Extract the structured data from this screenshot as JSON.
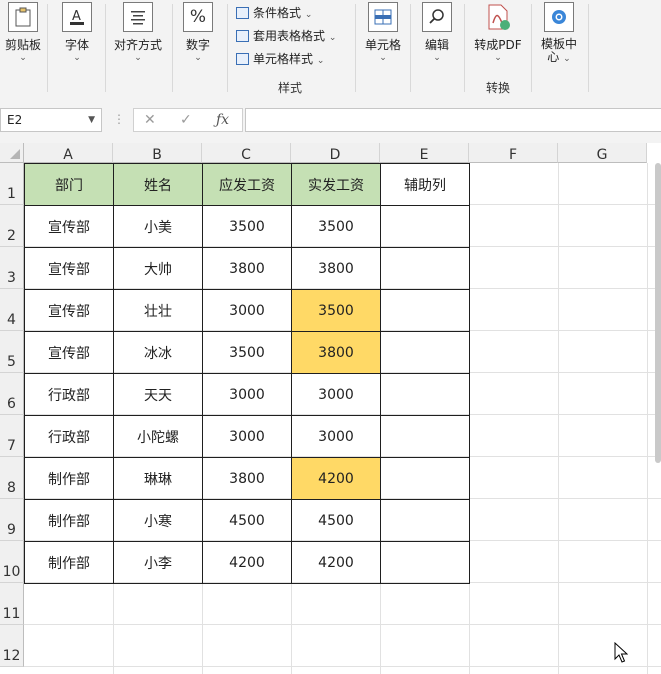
{
  "ribbon": {
    "clipboard": {
      "label": "剪贴板",
      "icon": "clipboard-icon"
    },
    "font": {
      "label": "字体",
      "icon": "font-color-icon"
    },
    "alignment": {
      "label": "对齐方式",
      "icon": "align-icon"
    },
    "number": {
      "label": "数字",
      "icon": "percent-icon",
      "glyph": "%"
    },
    "styles": {
      "conditional_format": "条件格式",
      "table_format": "套用表格格式",
      "cell_styles": "单元格样式",
      "group_label": "样式"
    },
    "cells": {
      "label": "单元格",
      "icon": "cells-icon"
    },
    "editing": {
      "label": "编辑",
      "icon": "search-icon"
    },
    "convert_pdf": {
      "label": "转成PDF",
      "icon": "pdf-icon"
    },
    "template_center": {
      "label_line1": "模板中",
      "label_line2": "心",
      "icon": "template-icon"
    },
    "convert_group_label": "转换"
  },
  "formula_bar": {
    "name_box": "E2",
    "formula": ""
  },
  "sheet": {
    "columns": [
      "A",
      "B",
      "C",
      "D",
      "E",
      "F",
      "G"
    ],
    "rows": [
      "1",
      "2",
      "3",
      "4",
      "5",
      "6",
      "7",
      "8",
      "9",
      "10",
      "11",
      "12"
    ],
    "headers": [
      "部门",
      "姓名",
      "应发工资",
      "实发工资",
      "辅助列"
    ],
    "data": [
      [
        "宣传部",
        "小美",
        "3500",
        "3500",
        ""
      ],
      [
        "宣传部",
        "大帅",
        "3800",
        "3800",
        ""
      ],
      [
        "宣传部",
        "壮壮",
        "3000",
        "3500",
        ""
      ],
      [
        "宣传部",
        "冰冰",
        "3500",
        "3800",
        ""
      ],
      [
        "行政部",
        "天天",
        "3000",
        "3000",
        ""
      ],
      [
        "行政部",
        "小陀螺",
        "3000",
        "3000",
        ""
      ],
      [
        "制作部",
        "琳琳",
        "3800",
        "4200",
        ""
      ],
      [
        "制作部",
        "小寒",
        "4500",
        "4500",
        ""
      ],
      [
        "制作部",
        "小李",
        "4200",
        "4200",
        ""
      ]
    ],
    "highlighted_rows": [
      2,
      3,
      6
    ],
    "colors": {
      "header_fill": "#c5e0b4",
      "highlight_fill": "#ffd966"
    }
  }
}
